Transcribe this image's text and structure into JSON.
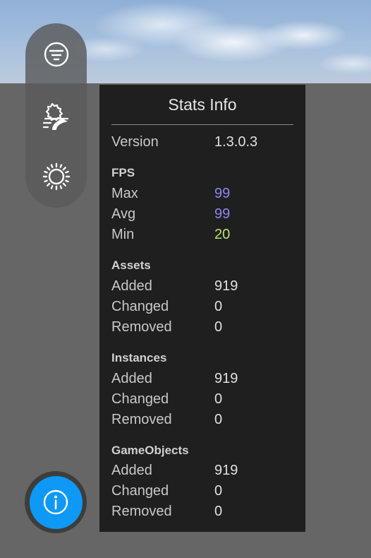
{
  "colors": {
    "panel_bg": "#1f1f1f",
    "fps_high": "#8a88f0",
    "fps_low": "#b7e36a",
    "info_button": "#0d99f5"
  },
  "toolbar": {
    "items": [
      {
        "icon": "filter-icon"
      },
      {
        "icon": "landscape-road-icon"
      },
      {
        "icon": "sun-icon"
      }
    ]
  },
  "info_button": {
    "icon": "info-icon"
  },
  "stats": {
    "title": "Stats Info",
    "version": {
      "label": "Version",
      "value": "1.3.0.3"
    },
    "fps": {
      "heading": "FPS",
      "max": {
        "label": "Max",
        "value": "99"
      },
      "avg": {
        "label": "Avg",
        "value": "99"
      },
      "min": {
        "label": "Min",
        "value": "20"
      }
    },
    "assets": {
      "heading": "Assets",
      "added": {
        "label": "Added",
        "value": "919"
      },
      "changed": {
        "label": "Changed",
        "value": "0"
      },
      "removed": {
        "label": "Removed",
        "value": "0"
      }
    },
    "instances": {
      "heading": "Instances",
      "added": {
        "label": "Added",
        "value": "919"
      },
      "changed": {
        "label": "Changed",
        "value": "0"
      },
      "removed": {
        "label": "Removed",
        "value": "0"
      }
    },
    "gameobjects": {
      "heading": "GameObjects",
      "added": {
        "label": "Added",
        "value": "919"
      },
      "changed": {
        "label": "Changed",
        "value": "0"
      },
      "removed": {
        "label": "Removed",
        "value": "0"
      }
    }
  }
}
